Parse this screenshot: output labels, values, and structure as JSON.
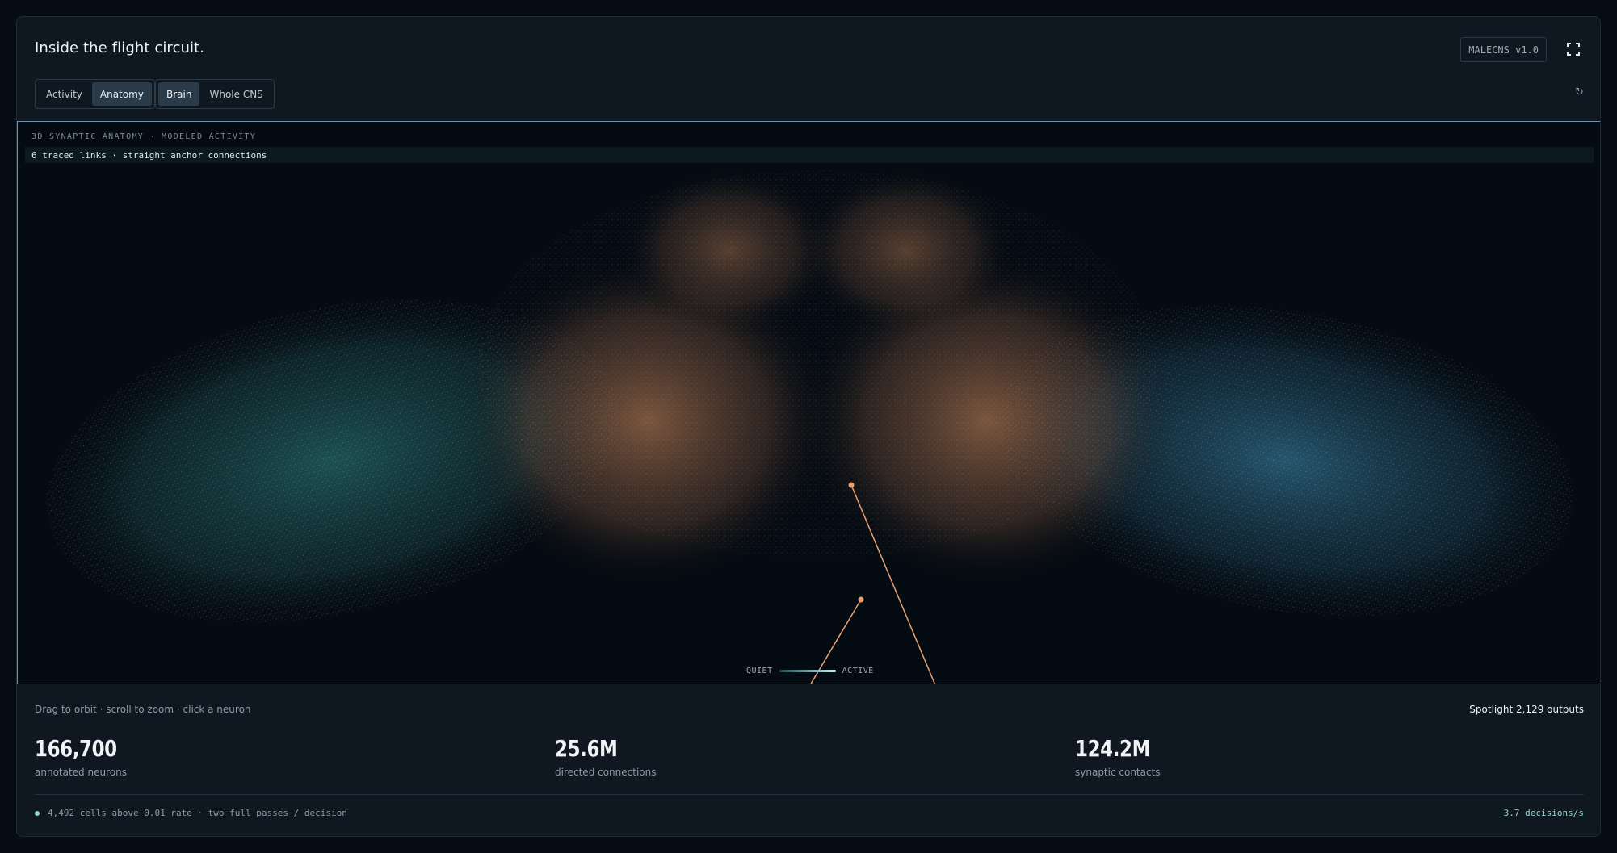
{
  "header": {
    "title": "Inside the flight circuit.",
    "version_badge": "MALECNS v1.0",
    "fullscreen_icon": "expand-icon"
  },
  "view_toggle": {
    "items": [
      {
        "label": "Activity",
        "active": false
      },
      {
        "label": "Anatomy",
        "active": true
      }
    ]
  },
  "scope_toggle": {
    "items": [
      {
        "label": "Brain",
        "active": true
      },
      {
        "label": "Whole CNS",
        "active": false
      }
    ]
  },
  "refresh_icon": "↻",
  "viewport": {
    "label": "3D SYNAPTIC ANATOMY · MODELED ACTIVITY",
    "status": "6 traced links · straight anchor connections",
    "legend": {
      "low": "QUIET",
      "high": "ACTIVE"
    },
    "colors": {
      "central": "#c8875a",
      "left_lobe": "#2f8a86",
      "right_lobe": "#3a86a8",
      "link": "#e8a070"
    }
  },
  "hint": "Drag to orbit · scroll to zoom · click a neuron",
  "spotlight": "Spotlight 2,129 outputs",
  "stats": [
    {
      "value": "166,700",
      "label": "annotated neurons"
    },
    {
      "value": "25.6M",
      "label": "directed connections"
    },
    {
      "value": "124.2M",
      "label": "synaptic contacts"
    }
  ],
  "footer": {
    "status": "4,492 cells above 0.01 rate · two full passes / decision",
    "rate": "3.7 decisions/s"
  }
}
